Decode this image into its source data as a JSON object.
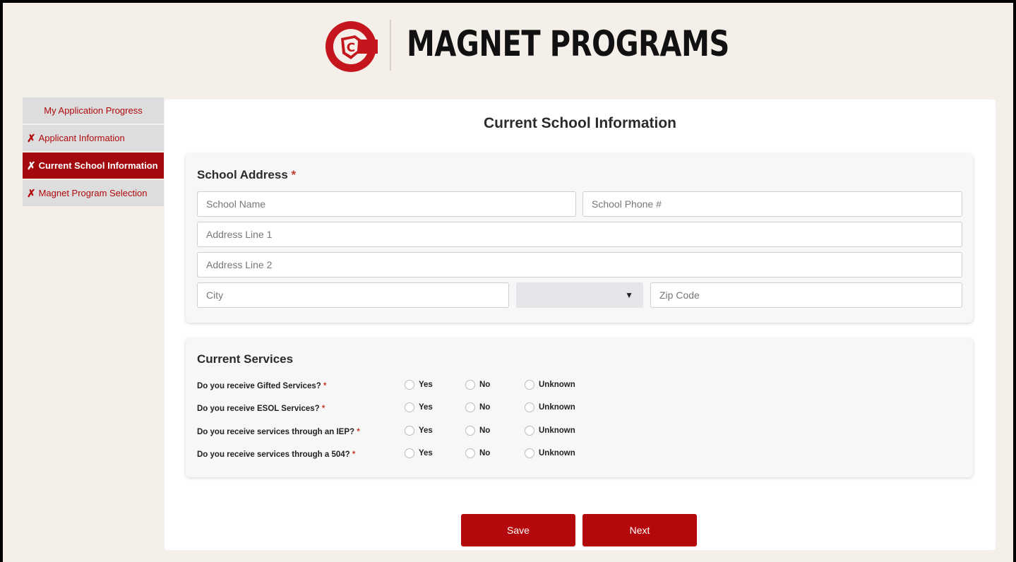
{
  "header": {
    "title": "MAGNET PROGRAMS",
    "logo_icon": "c-shield-logo",
    "brand_color": "#c4161c"
  },
  "sidebar": {
    "items": [
      {
        "label": "My Application Progress",
        "mark": ""
      },
      {
        "label": "Applicant Information",
        "mark": "✗"
      },
      {
        "label": "Current School Information",
        "mark": "✗"
      },
      {
        "label": "Magnet Program Selection",
        "mark": "✗"
      }
    ]
  },
  "main": {
    "title": "Current School Information",
    "address": {
      "title": "School Address",
      "required_mark": "*",
      "school_name_placeholder": "School Name",
      "school_phone_placeholder": "School Phone #",
      "address1_placeholder": "Address Line 1",
      "address2_placeholder": "Address Line 2",
      "city_placeholder": "City",
      "state_value": "",
      "state_arrow": "▼",
      "zip_placeholder": "Zip Code"
    },
    "services": {
      "title": "Current Services",
      "required_mark": "*",
      "options": [
        "Yes",
        "No",
        "Unknown"
      ],
      "questions": [
        "Do you receive Gifted Services?",
        "Do you receive ESOL Services?",
        "Do you receive services through an IEP?",
        "Do you receive services through a 504?"
      ]
    },
    "buttons": {
      "save": "Save",
      "next": "Next"
    }
  }
}
